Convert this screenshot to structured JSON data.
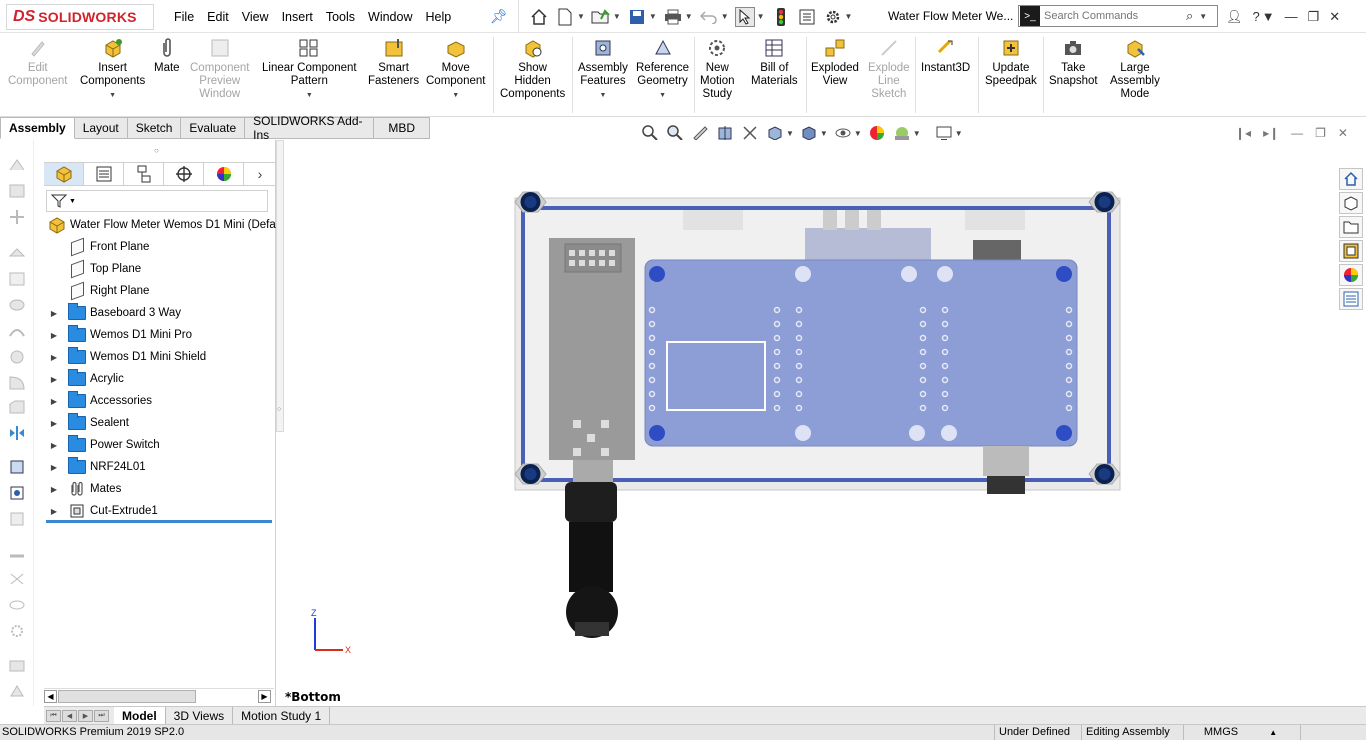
{
  "app": {
    "logo_prefix": "DS",
    "logo_text": "SOLIDWORKS",
    "menus": [
      "File",
      "Edit",
      "View",
      "Insert",
      "Tools",
      "Window",
      "Help"
    ],
    "document_title": "Water Flow Meter We...",
    "search_placeholder": "Search Commands"
  },
  "command_manager": {
    "buttons": [
      {
        "label_lines": [
          "Edit",
          "Component"
        ],
        "disabled": true
      },
      {
        "label_lines": [
          "Insert",
          "Components"
        ],
        "disabled": false
      },
      {
        "label_lines": [
          "Mate"
        ],
        "disabled": false
      },
      {
        "label_lines": [
          "Component",
          "Preview",
          "Window"
        ],
        "disabled": true
      },
      {
        "label_lines": [
          "Linear Component",
          "Pattern"
        ],
        "disabled": false
      },
      {
        "label_lines": [
          "Smart",
          "Fasteners"
        ],
        "disabled": false
      },
      {
        "label_lines": [
          "Move",
          "Component"
        ],
        "disabled": false
      },
      {
        "label_lines": [
          "Show",
          "Hidden",
          "Components"
        ],
        "disabled": false
      },
      {
        "label_lines": [
          "Assembly",
          "Features"
        ],
        "disabled": false
      },
      {
        "label_lines": [
          "Reference",
          "Geometry"
        ],
        "disabled": false
      },
      {
        "label_lines": [
          "New",
          "Motion",
          "Study"
        ],
        "disabled": false
      },
      {
        "label_lines": [
          "Bill of",
          "Materials"
        ],
        "disabled": false
      },
      {
        "label_lines": [
          "Exploded",
          "View"
        ],
        "disabled": false
      },
      {
        "label_lines": [
          "Explode",
          "Line",
          "Sketch"
        ],
        "disabled": true
      },
      {
        "label_lines": [
          "Instant3D"
        ],
        "disabled": false
      },
      {
        "label_lines": [
          "Update",
          "Speedpak"
        ],
        "disabled": false
      },
      {
        "label_lines": [
          "Take",
          "Snapshot"
        ],
        "disabled": false
      },
      {
        "label_lines": [
          "Large",
          "Assembly",
          "Mode"
        ],
        "disabled": false
      }
    ]
  },
  "tabs": [
    {
      "label": "Assembly",
      "active": true
    },
    {
      "label": "Layout",
      "active": false
    },
    {
      "label": "Sketch",
      "active": false
    },
    {
      "label": "Evaluate",
      "active": false
    },
    {
      "label": "SOLIDWORKS Add-Ins",
      "active": false
    },
    {
      "label": "MBD",
      "active": false
    }
  ],
  "feature_tree": {
    "root": "Water Flow Meter Wemos D1 Mini  (Defaul",
    "items": [
      {
        "label": "Front Plane",
        "type": "plane",
        "expandable": false
      },
      {
        "label": "Top Plane",
        "type": "plane",
        "expandable": false
      },
      {
        "label": "Right Plane",
        "type": "plane",
        "expandable": false
      },
      {
        "label": "Baseboard 3 Way",
        "type": "folder",
        "expandable": true
      },
      {
        "label": "Wemos D1 Mini Pro",
        "type": "folder",
        "expandable": true
      },
      {
        "label": "Wemos D1 Mini Shield",
        "type": "folder",
        "expandable": true
      },
      {
        "label": "Acrylic",
        "type": "folder",
        "expandable": true
      },
      {
        "label": "Accessories",
        "type": "folder",
        "expandable": true
      },
      {
        "label": "Sealent",
        "type": "folder",
        "expandable": true
      },
      {
        "label": "Power Switch",
        "type": "folder",
        "expandable": true
      },
      {
        "label": "NRF24L01",
        "type": "folder",
        "expandable": true
      },
      {
        "label": "Mates",
        "type": "mates",
        "expandable": true
      },
      {
        "label": "Cut-Extrude1",
        "type": "feature",
        "expandable": true
      }
    ]
  },
  "viewport": {
    "orientation_label": "*Bottom",
    "triad": {
      "z": "Z",
      "x": "X"
    }
  },
  "bottom_tabs": [
    {
      "label": "Model",
      "active": true
    },
    {
      "label": "3D Views",
      "active": false
    },
    {
      "label": "Motion Study 1",
      "active": false
    }
  ],
  "status": {
    "product": "SOLIDWORKS Premium 2019 SP2.0",
    "state": "Under Defined",
    "mode": "Editing Assembly",
    "units": "MMGS"
  },
  "colors": {
    "accent_blue": "#3a88cf",
    "brand_red": "#d2232a",
    "pcb_blue": "#8d9dd6",
    "frame_blue": "#4a5fb6"
  }
}
